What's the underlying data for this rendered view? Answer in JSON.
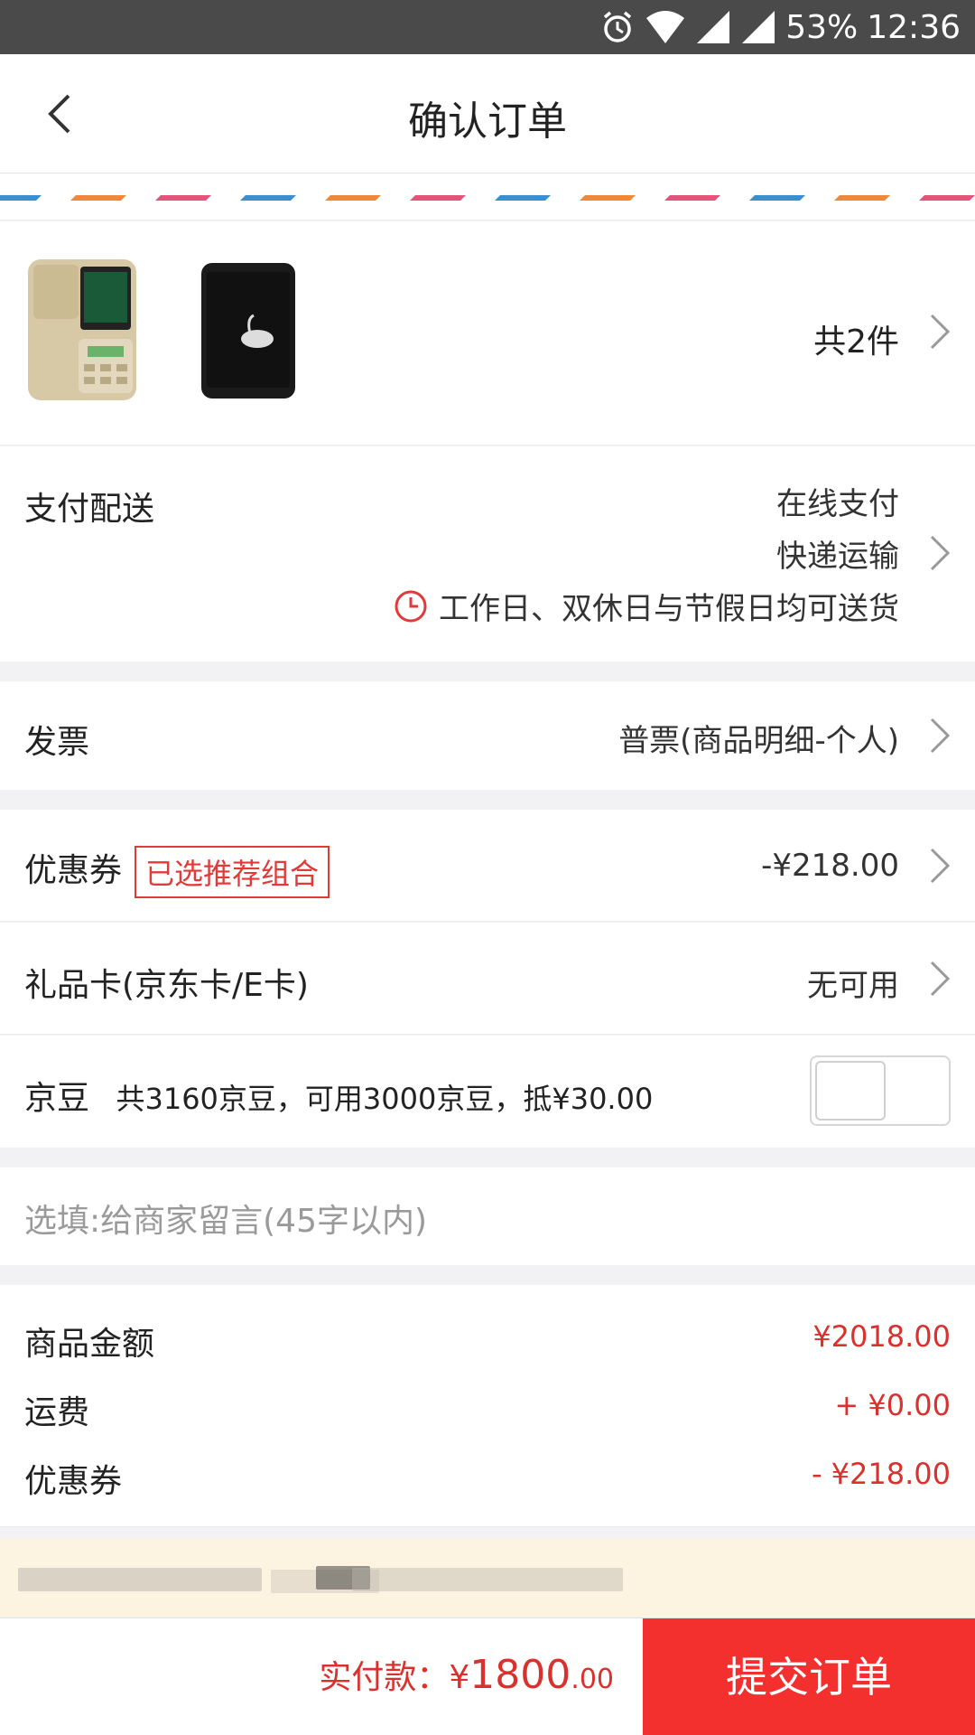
{
  "status_bar": {
    "battery": "53%",
    "time": "12:36"
  },
  "header": {
    "title": "确认订单"
  },
  "products": {
    "count_label": "共2件"
  },
  "delivery": {
    "label": "支付配送",
    "payment": "在线支付",
    "shipping": "快递运输",
    "schedule": "工作日、双休日与节假日均可送货"
  },
  "invoice": {
    "label": "发票",
    "value": "普票(商品明细-个人)"
  },
  "coupon": {
    "label": "优惠券",
    "tag": "已选推荐组合",
    "value": "-¥218.00"
  },
  "giftcard": {
    "label": "礼品卡(京东卡/E卡)",
    "value": "无可用"
  },
  "jingdou": {
    "label": "京豆",
    "desc": "共3160京豆，可用3000京豆，抵¥30.00",
    "enabled": false
  },
  "message": {
    "placeholder": "选填:给商家留言(45字以内)"
  },
  "summary": {
    "items": [
      {
        "label": "商品金额",
        "value": "¥2018.00"
      },
      {
        "label": "运费",
        "value": "+ ¥0.00"
      },
      {
        "label": "优惠券",
        "value": "- ¥218.00"
      }
    ]
  },
  "bottom": {
    "pay_label": "实付款：",
    "currency": "¥",
    "amount_main": "1800",
    "amount_decimal": ".00",
    "submit_label": "提交订单"
  },
  "colors": {
    "accent": "#f3302e",
    "price": "#d9312e",
    "notice_bg": "#fdf3e1"
  }
}
